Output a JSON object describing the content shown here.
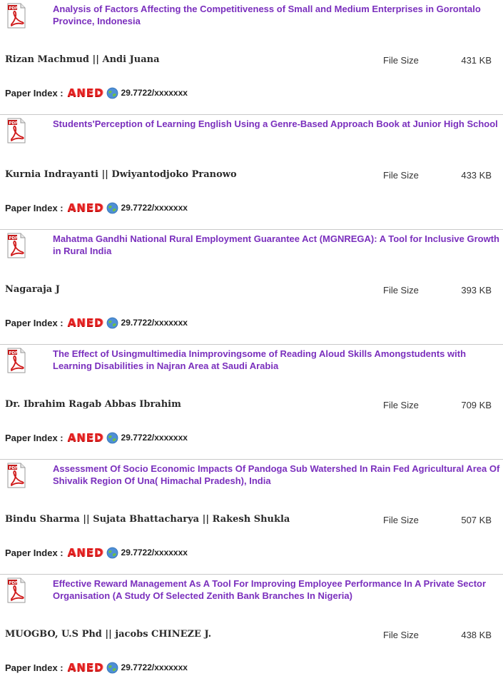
{
  "labels": {
    "file_size": "File Size",
    "paper_index": "Paper Index :",
    "index_logo": "ANED"
  },
  "papers": [
    {
      "title": "Analysis of Factors Affecting the Competitiveness of Small and Medium Enterprises in Gorontalo Province, Indonesia",
      "authors": "Rizan Machmud || Andi Juana",
      "file_size": "431 KB",
      "doi": "29.7722/xxxxxxx"
    },
    {
      "title": "Students'Perception of Learning English Using a Genre-Based Approach Book at Junior High School",
      "authors": "Kurnia Indrayanti || Dwiyantodjoko Pranowo",
      "file_size": "433 KB",
      "doi": "29.7722/xxxxxxx"
    },
    {
      "title": "Mahatma Gandhi National Rural Employment Guarantee Act (MGNREGA): A Tool for Inclusive Growth in Rural India",
      "authors": "Nagaraja J",
      "file_size": "393 KB",
      "doi": "29.7722/xxxxxxx"
    },
    {
      "title": "The Effect of Usingmultimedia Inimprovingsome of Reading Aloud Skills Amongstudents with Learning Disabilities in Najran Area at Saudi Arabia",
      "authors": "Dr. Ibrahim Ragab Abbas Ibrahim",
      "file_size": "709 KB",
      "doi": "29.7722/xxxxxxx"
    },
    {
      "title": "Assessment Of Socio Economic Impacts Of Pandoga Sub Watershed In Rain Fed Agricultural Area Of Shivalik Region Of Una( Himachal Pradesh), India",
      "authors": "Bindu Sharma || Sujata Bhattacharya || Rakesh Shukla",
      "file_size": "507 KB",
      "doi": "29.7722/xxxxxxx"
    },
    {
      "title": "Effective Reward Management As A Tool For Improving Employee Performance In A Private Sector Organisation (A Study Of Selected Zenith Bank Branches In Nigeria)",
      "authors": "MUOGBO, U.S Phd || jacobs CHINEZE J.",
      "file_size": "438 KB",
      "doi": "29.7722/xxxxxxx"
    }
  ]
}
